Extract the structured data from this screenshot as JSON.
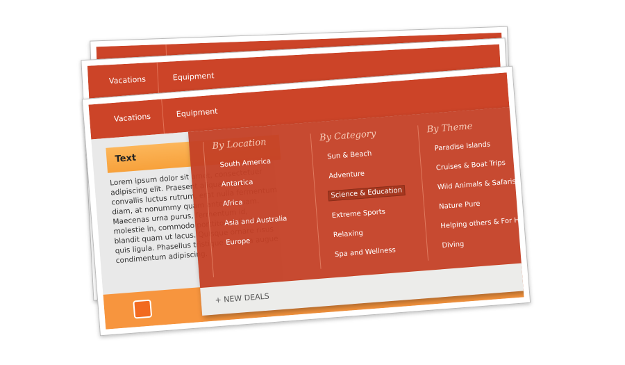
{
  "nav": {
    "items": [
      "Vacations",
      "Equipment"
    ]
  },
  "sidebar": {
    "heading": "Text",
    "body": "Lorem ipsum dolor sit amet, consectetuer adipiscing elit. Praesent aliquam, justo convallis luctus rutrum, erat nulla fermentum diam, at nonummy quam ante ac quam. Maecenas urna purus, fermentum id, molestie in, commodo porttitor, felis. Nam blandit quam ut lacus. Quisque ornare risus quis ligula. Phasellus tristique purus a augue condimentum adipiscing."
  },
  "dropdown": {
    "columns": [
      {
        "title": "By Location",
        "items": [
          "South America",
          "Antartica",
          "Africa",
          "Asia and Australia",
          "Europe"
        ]
      },
      {
        "title": "By Category",
        "items": [
          "Sun & Beach",
          "Adventure",
          "Science & Education",
          "Extreme Sports",
          "Relaxing",
          "Spa and Wellness"
        ],
        "highlighted": "Science & Education"
      },
      {
        "title": "By Theme",
        "items": [
          "Paradise Islands",
          "Cruises & Boat Trips",
          "Wild Animals & Safaris",
          "Nature Pure",
          "Helping others & For Hope",
          "Diving"
        ]
      }
    ],
    "footer_link": "+ NEW DEALS"
  },
  "icons": {
    "footer": "rss-icon"
  },
  "colors": {
    "nav": "#cc4428",
    "accent": "#f7953e",
    "dropdown": "#c44026"
  }
}
